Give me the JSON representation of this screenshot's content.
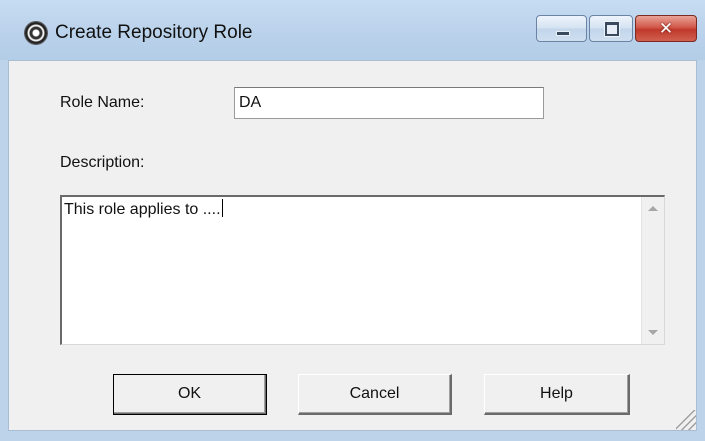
{
  "window": {
    "title": "Create Repository Role",
    "close_glyph": "✕",
    "icons": [
      "app-disc-icon",
      "minimize-icon",
      "maximize-icon",
      "close-icon"
    ]
  },
  "form": {
    "role_name_label": "Role Name:",
    "role_name_value": "DA",
    "description_label": "Description:",
    "description_value": "This role applies to ...."
  },
  "buttons": {
    "ok": "OK",
    "cancel": "Cancel",
    "help": "Help"
  },
  "colors": {
    "title_bar": "#b9d1ea",
    "close_button": "#c0392b",
    "dialog_face": "#f0f0f0"
  }
}
